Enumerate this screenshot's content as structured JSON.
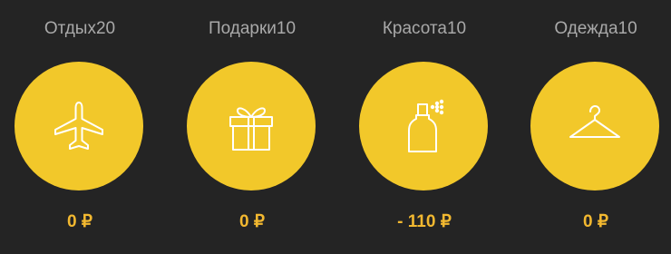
{
  "colors": {
    "background": "#242424",
    "accent": "#f2c82a",
    "amount": "#f2b830",
    "label": "#a9a9a9",
    "icon_stroke": "#ffffff"
  },
  "categories": [
    {
      "name": "Отдых20",
      "icon": "airplane-icon",
      "amount": "0 ₽"
    },
    {
      "name": "Подарки10",
      "icon": "gift-icon",
      "amount": "0 ₽"
    },
    {
      "name": "Красота10",
      "icon": "perfume-spray-icon",
      "amount": "- 110 ₽"
    },
    {
      "name": "Одежда10",
      "icon": "hanger-icon",
      "amount": "0 ₽"
    }
  ]
}
